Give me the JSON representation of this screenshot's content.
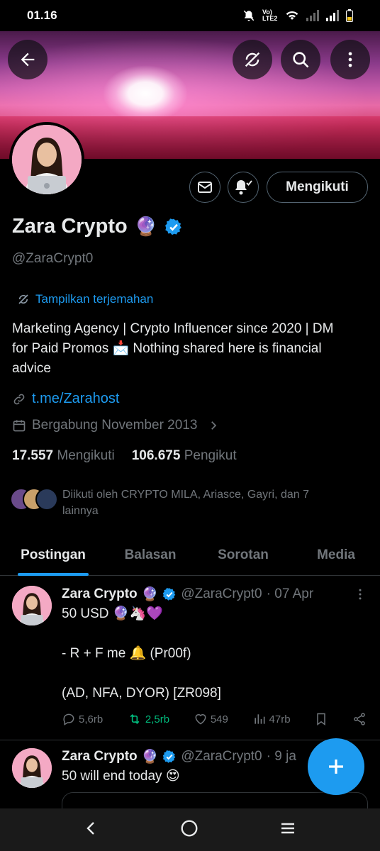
{
  "status": {
    "time": "01.16",
    "network_label": "Vo) LTE2"
  },
  "header": {
    "back_icon": "arrow-left-icon",
    "translate_icon": "translate-off-icon",
    "search_icon": "search-icon",
    "more_icon": "more-vertical-icon"
  },
  "profile": {
    "name": "Zara Crypto",
    "name_emoji": "🔮",
    "handle": "@ZaraCrypt0",
    "follow_button": "Mengikuti",
    "translate_label": "Tampilkan terjemahan",
    "bio": "Marketing Agency | Crypto Influencer since 2020 | DM for Paid Promos 📩 Nothing shared here is financial advice",
    "link": "t.me/Zarahost",
    "joined": "Bergabung November 2013",
    "following_count": "17.557",
    "following_label": "Mengikuti",
    "followers_count": "106.675",
    "followers_label": "Pengikut",
    "followed_by": "Diikuti oleh CRYPTO MILA, Ariasce, Gayri, dan 7 lainnya"
  },
  "tabs": [
    {
      "label": "Postingan",
      "active": true
    },
    {
      "label": "Balasan",
      "active": false
    },
    {
      "label": "Sorotan",
      "active": false
    },
    {
      "label": "Media",
      "active": false
    }
  ],
  "posts": [
    {
      "name": "Zara Crypto",
      "emoji": "🔮",
      "handle": "@ZaraCrypt0",
      "date": "· 07 Apr",
      "text": "50 USD 🔮🦄💜\n\n- R + F me 🔔 (Pr00f)\n\n(AD, NFA, DYOR) [ZR098]",
      "replies": "5,6rb",
      "reposts": "2,5rb",
      "likes": "549",
      "views": "47rb"
    },
    {
      "name": "Zara Crypto",
      "emoji": "🔮",
      "handle": "@ZaraCrypt0",
      "date": "· 9 ja",
      "text": "50 will end today 😍"
    }
  ],
  "colors": {
    "accent": "#1d9bf0",
    "repost": "#00ba7c",
    "muted": "#71767b"
  }
}
